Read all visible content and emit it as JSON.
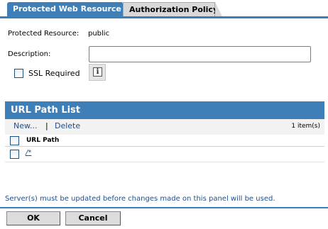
{
  "tabs": [
    {
      "label": "Protected Web Resource",
      "active": true
    },
    {
      "label": "Authorization Policy",
      "active": false
    }
  ],
  "form": {
    "protected_resource_label": "Protected Resource:",
    "protected_resource_value": "public",
    "description_label": "Description:",
    "description_value": "",
    "ssl_label": "SSL Required",
    "ssl_checked": false,
    "info_icon": "info-icon"
  },
  "url_list": {
    "title": "URL Path List",
    "new_label": "New...",
    "separator": "|",
    "delete_label": "Delete",
    "count": "1 item(s)",
    "column_header": "URL Path",
    "rows": [
      {
        "path": "/*",
        "checked": false
      }
    ]
  },
  "status_message": "Server(s) must be updated before changes made on this panel will be used.",
  "buttons": {
    "ok_label": "OK",
    "cancel_label": "Cancel"
  },
  "colors": {
    "accent": "#3f7fb7",
    "link": "#1f4e8c"
  }
}
